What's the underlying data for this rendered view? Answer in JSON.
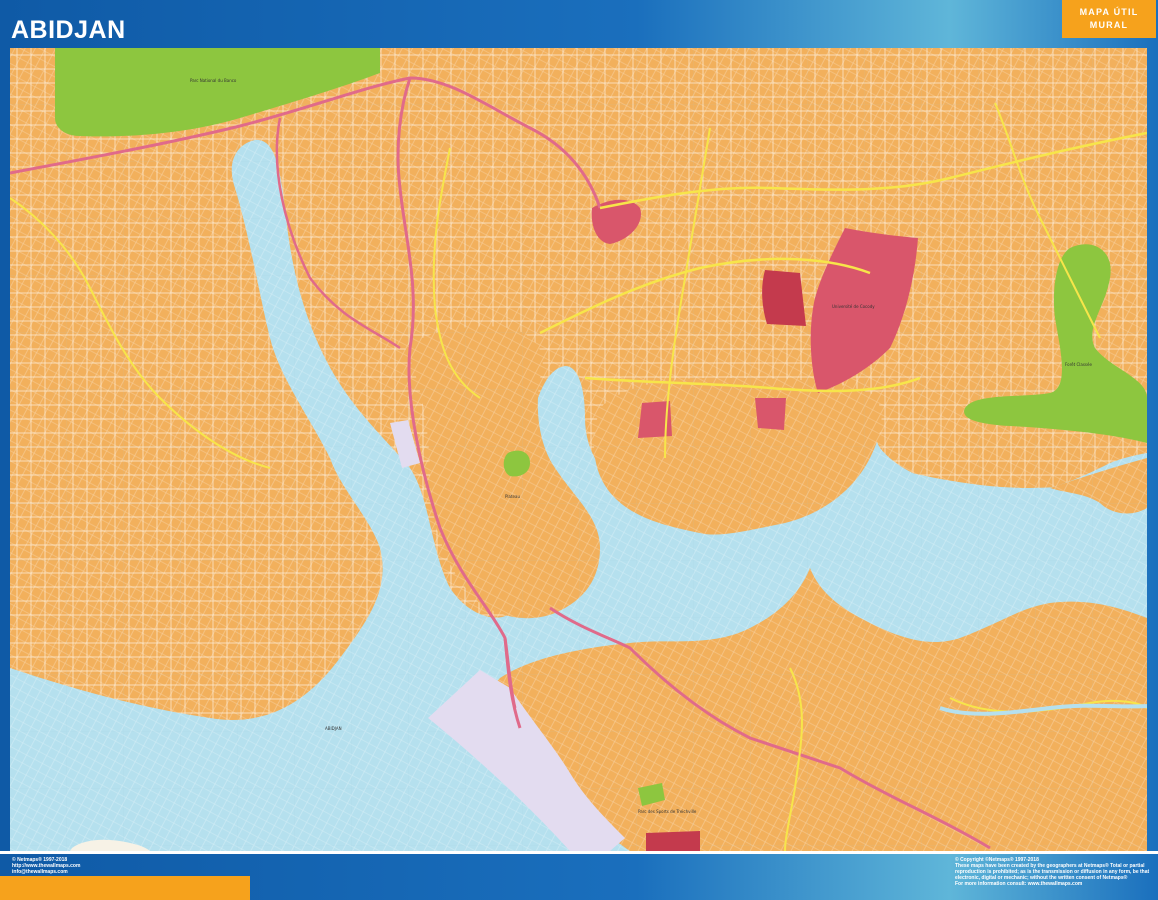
{
  "header": {
    "title": "ABIDJAN",
    "badge_line1": "MAPA ÚTIL",
    "badge_line2": "MURAL"
  },
  "map": {
    "labels": {
      "park_north": "Parc National du Banco",
      "lagoon": "ABIDJAN",
      "park_east": "Forêt Classée",
      "university": "Université de Cocody",
      "park_south": "Parc des Sports de Treichville",
      "plateau": "Plateau"
    }
  },
  "footer": {
    "left_line1": "© Netmaps® 1997-2018",
    "left_line2": "http://www.thewallmaps.com",
    "left_line3": "info@thewallmaps.com",
    "right_line1": "© Copyright ©Netmaps® 1997-2018",
    "right_line2": "These maps have been created by the geographers at Netmaps® Total or partial",
    "right_line3": "reproduction is prohibited; as is the transmission or diffusion in any form, be that",
    "right_line4": "electronic, digital or mechanic; without the written consent of Netmaps®",
    "right_line5": "For more information consult: www.thewallmaps.com"
  },
  "colors": {
    "land": "#f2b05c",
    "water": "#b5e0ee",
    "park": "#8dc63f",
    "university": "#d9566b",
    "highway": "#e06a8a",
    "main_road": "#f7e54a",
    "street": "#ffffff",
    "port": "#e3dcf0",
    "frame": "#1565b0",
    "accent": "#f6a21c"
  }
}
